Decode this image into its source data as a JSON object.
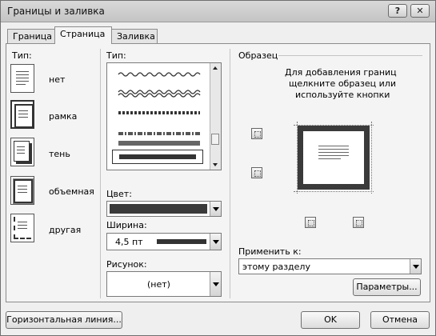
{
  "window": {
    "title": "Границы и заливка",
    "help_icon": "?",
    "close_icon": "✕"
  },
  "tabs": [
    {
      "label": "Граница"
    },
    {
      "label": "Страница"
    },
    {
      "label": "Заливка"
    }
  ],
  "settings": {
    "heading": "Тип:",
    "items": [
      {
        "label": "нет"
      },
      {
        "label": "рамка"
      },
      {
        "label": "тень"
      },
      {
        "label": "объемная"
      },
      {
        "label": "другая"
      }
    ]
  },
  "style_section": {
    "label": "Тип:"
  },
  "color": {
    "label": "Цвет:",
    "value_color": "#3a3a3a"
  },
  "width": {
    "label": "Ширина:",
    "value": "4,5 пт"
  },
  "art": {
    "label": "Рисунок:",
    "value": "(нет)"
  },
  "preview": {
    "heading": "Образец",
    "hint_line1": "Для добавления границ",
    "hint_line2": "щелкните образец или",
    "hint_line3": "используйте кнопки"
  },
  "apply_to": {
    "label": "Применить к:",
    "value": "этому разделу"
  },
  "buttons": {
    "options": "Параметры...",
    "horizontal_line": "Горизонтальная линия...",
    "ok": "OK",
    "cancel": "Отмена"
  }
}
